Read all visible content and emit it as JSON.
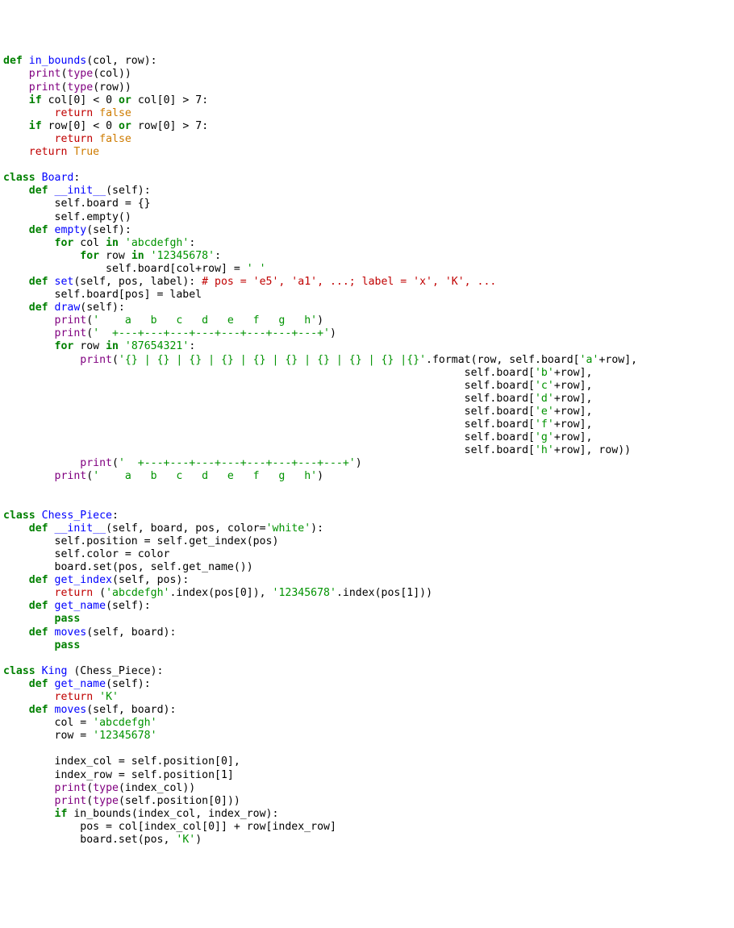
{
  "code": {
    "lines": [
      [
        [
          "kw",
          "def "
        ],
        [
          "name",
          "in_bounds"
        ],
        [
          "n",
          "(col, row):"
        ]
      ],
      [
        [
          "n",
          "    "
        ],
        [
          "purple",
          "print"
        ],
        [
          "n",
          "("
        ],
        [
          "purple",
          "type"
        ],
        [
          "n",
          "(col))"
        ]
      ],
      [
        [
          "n",
          "    "
        ],
        [
          "purple",
          "print"
        ],
        [
          "n",
          "("
        ],
        [
          "purple",
          "type"
        ],
        [
          "n",
          "(row))"
        ]
      ],
      [
        [
          "n",
          "    "
        ],
        [
          "kw",
          "if"
        ],
        [
          "n",
          " col["
        ],
        [
          "n",
          "0"
        ],
        [
          "n",
          "] < "
        ],
        [
          "n",
          "0"
        ],
        [
          "n",
          " "
        ],
        [
          "kw",
          "or"
        ],
        [
          "n",
          " col["
        ],
        [
          "n",
          "0"
        ],
        [
          "n",
          "] > "
        ],
        [
          "n",
          "7"
        ],
        [
          "n",
          ":"
        ]
      ],
      [
        [
          "n",
          "        "
        ],
        [
          "red",
          "return"
        ],
        [
          "n",
          " "
        ],
        [
          "orange",
          "false"
        ]
      ],
      [
        [
          "n",
          "    "
        ],
        [
          "kw",
          "if"
        ],
        [
          "n",
          " row["
        ],
        [
          "n",
          "0"
        ],
        [
          "n",
          "] < "
        ],
        [
          "n",
          "0"
        ],
        [
          "n",
          " "
        ],
        [
          "kw",
          "or"
        ],
        [
          "n",
          " row["
        ],
        [
          "n",
          "0"
        ],
        [
          "n",
          "] > "
        ],
        [
          "n",
          "7"
        ],
        [
          "n",
          ":"
        ]
      ],
      [
        [
          "n",
          "        "
        ],
        [
          "red",
          "return"
        ],
        [
          "n",
          " "
        ],
        [
          "orange",
          "false"
        ]
      ],
      [
        [
          "n",
          "    "
        ],
        [
          "red",
          "return"
        ],
        [
          "n",
          " "
        ],
        [
          "orange",
          "True"
        ]
      ],
      [
        [
          "n",
          ""
        ]
      ],
      [
        [
          "kw",
          "class "
        ],
        [
          "name",
          "Board"
        ],
        [
          "n",
          ":"
        ]
      ],
      [
        [
          "n",
          "    "
        ],
        [
          "kw",
          "def "
        ],
        [
          "name",
          "__init__"
        ],
        [
          "n",
          "(self):"
        ]
      ],
      [
        [
          "n",
          "        self.board = {}"
        ]
      ],
      [
        [
          "n",
          "        self.empty()"
        ]
      ],
      [
        [
          "n",
          "    "
        ],
        [
          "kw",
          "def "
        ],
        [
          "name",
          "empty"
        ],
        [
          "n",
          "(self):"
        ]
      ],
      [
        [
          "n",
          "        "
        ],
        [
          "kw",
          "for"
        ],
        [
          "n",
          " col "
        ],
        [
          "kw",
          "in"
        ],
        [
          "n",
          " "
        ],
        [
          "str",
          "'abcdefgh'"
        ],
        [
          "n",
          ":"
        ]
      ],
      [
        [
          "n",
          "            "
        ],
        [
          "kw",
          "for"
        ],
        [
          "n",
          " row "
        ],
        [
          "kw",
          "in"
        ],
        [
          "n",
          " "
        ],
        [
          "str",
          "'12345678'"
        ],
        [
          "n",
          ":"
        ]
      ],
      [
        [
          "n",
          "                self.board[col+row] = "
        ],
        [
          "str",
          "' '"
        ]
      ],
      [
        [
          "n",
          "    "
        ],
        [
          "kw",
          "def "
        ],
        [
          "name",
          "set"
        ],
        [
          "n",
          "(self, pos, label): "
        ],
        [
          "cmt",
          "# pos = 'e5', 'a1', ...; label = 'x', 'K', ..."
        ]
      ],
      [
        [
          "n",
          "        self.board[pos] = label"
        ]
      ],
      [
        [
          "n",
          "    "
        ],
        [
          "kw",
          "def "
        ],
        [
          "name",
          "draw"
        ],
        [
          "n",
          "(self):"
        ]
      ],
      [
        [
          "n",
          "        "
        ],
        [
          "purple",
          "print"
        ],
        [
          "n",
          "("
        ],
        [
          "str",
          "'    a   b   c   d   e   f   g   h'"
        ],
        [
          "n",
          ")"
        ]
      ],
      [
        [
          "n",
          "        "
        ],
        [
          "purple",
          "print"
        ],
        [
          "n",
          "("
        ],
        [
          "str",
          "'  +---+---+---+---+---+---+---+---+'"
        ],
        [
          "n",
          ")"
        ]
      ],
      [
        [
          "n",
          "        "
        ],
        [
          "kw",
          "for"
        ],
        [
          "n",
          " row "
        ],
        [
          "kw",
          "in"
        ],
        [
          "n",
          " "
        ],
        [
          "str",
          "'87654321'"
        ],
        [
          "n",
          ":"
        ]
      ],
      [
        [
          "n",
          "            "
        ],
        [
          "purple",
          "print"
        ],
        [
          "n",
          "("
        ],
        [
          "str",
          "'{} | {} | {} | {} | {} | {} | {} | {} | {} |{}'"
        ],
        [
          "n",
          ".format(row, self.board["
        ],
        [
          "str",
          "'a'"
        ],
        [
          "n",
          "+row],"
        ]
      ],
      [
        [
          "n",
          "                                                                        self.board["
        ],
        [
          "str",
          "'b'"
        ],
        [
          "n",
          "+row],"
        ]
      ],
      [
        [
          "n",
          "                                                                        self.board["
        ],
        [
          "str",
          "'c'"
        ],
        [
          "n",
          "+row],"
        ]
      ],
      [
        [
          "n",
          "                                                                        self.board["
        ],
        [
          "str",
          "'d'"
        ],
        [
          "n",
          "+row],"
        ]
      ],
      [
        [
          "n",
          "                                                                        self.board["
        ],
        [
          "str",
          "'e'"
        ],
        [
          "n",
          "+row],"
        ]
      ],
      [
        [
          "n",
          "                                                                        self.board["
        ],
        [
          "str",
          "'f'"
        ],
        [
          "n",
          "+row],"
        ]
      ],
      [
        [
          "n",
          "                                                                        self.board["
        ],
        [
          "str",
          "'g'"
        ],
        [
          "n",
          "+row],"
        ]
      ],
      [
        [
          "n",
          "                                                                        self.board["
        ],
        [
          "str",
          "'h'"
        ],
        [
          "n",
          "+row], row))"
        ]
      ],
      [
        [
          "n",
          "            "
        ],
        [
          "purple",
          "print"
        ],
        [
          "n",
          "("
        ],
        [
          "str",
          "'  +---+---+---+---+---+---+---+---+'"
        ],
        [
          "n",
          ")"
        ]
      ],
      [
        [
          "n",
          "        "
        ],
        [
          "purple",
          "print"
        ],
        [
          "n",
          "("
        ],
        [
          "str",
          "'    a   b   c   d   e   f   g   h'"
        ],
        [
          "n",
          ")"
        ]
      ],
      [
        [
          "n",
          ""
        ]
      ],
      [
        [
          "n",
          ""
        ]
      ],
      [
        [
          "kw",
          "class "
        ],
        [
          "name",
          "Chess_Piece"
        ],
        [
          "n",
          ":"
        ]
      ],
      [
        [
          "n",
          "    "
        ],
        [
          "kw",
          "def "
        ],
        [
          "name",
          "__init__"
        ],
        [
          "n",
          "(self, board, pos, color="
        ],
        [
          "str",
          "'white'"
        ],
        [
          "n",
          "):"
        ]
      ],
      [
        [
          "n",
          "        self.position = self.get_index(pos)"
        ]
      ],
      [
        [
          "n",
          "        self.color = color"
        ]
      ],
      [
        [
          "n",
          "        board.set(pos, self.get_name())"
        ]
      ],
      [
        [
          "n",
          "    "
        ],
        [
          "kw",
          "def "
        ],
        [
          "name",
          "get_index"
        ],
        [
          "n",
          "(self, pos):"
        ]
      ],
      [
        [
          "n",
          "        "
        ],
        [
          "red",
          "return"
        ],
        [
          "n",
          " ("
        ],
        [
          "str",
          "'abcdefgh'"
        ],
        [
          "n",
          ".index(pos["
        ],
        [
          "n",
          "0"
        ],
        [
          "n",
          "]), "
        ],
        [
          "str",
          "'12345678'"
        ],
        [
          "n",
          ".index(pos["
        ],
        [
          "n",
          "1"
        ],
        [
          "n",
          "]))"
        ]
      ],
      [
        [
          "n",
          "    "
        ],
        [
          "kw",
          "def "
        ],
        [
          "name",
          "get_name"
        ],
        [
          "n",
          "(self):"
        ]
      ],
      [
        [
          "n",
          "        "
        ],
        [
          "kw",
          "pass"
        ]
      ],
      [
        [
          "n",
          "    "
        ],
        [
          "kw",
          "def "
        ],
        [
          "name",
          "moves"
        ],
        [
          "n",
          "(self, board):"
        ]
      ],
      [
        [
          "n",
          "        "
        ],
        [
          "kw",
          "pass"
        ]
      ],
      [
        [
          "n",
          ""
        ]
      ],
      [
        [
          "kw",
          "class "
        ],
        [
          "name",
          "King"
        ],
        [
          "n",
          " (Chess_Piece):"
        ]
      ],
      [
        [
          "n",
          "    "
        ],
        [
          "kw",
          "def "
        ],
        [
          "name",
          "get_name"
        ],
        [
          "n",
          "(self):"
        ]
      ],
      [
        [
          "n",
          "        "
        ],
        [
          "red",
          "return"
        ],
        [
          "n",
          " "
        ],
        [
          "str",
          "'K'"
        ]
      ],
      [
        [
          "n",
          "    "
        ],
        [
          "kw",
          "def "
        ],
        [
          "name",
          "moves"
        ],
        [
          "n",
          "(self, board):"
        ]
      ],
      [
        [
          "n",
          "        col = "
        ],
        [
          "str",
          "'abcdefgh'"
        ]
      ],
      [
        [
          "n",
          "        row = "
        ],
        [
          "str",
          "'12345678'"
        ]
      ],
      [
        [
          "n",
          ""
        ]
      ],
      [
        [
          "n",
          "        index_col = self.position["
        ],
        [
          "n",
          "0"
        ],
        [
          "n",
          "],"
        ]
      ],
      [
        [
          "n",
          "        index_row = self.position["
        ],
        [
          "n",
          "1"
        ],
        [
          "n",
          "]"
        ]
      ],
      [
        [
          "n",
          "        "
        ],
        [
          "purple",
          "print"
        ],
        [
          "n",
          "("
        ],
        [
          "purple",
          "type"
        ],
        [
          "n",
          "(index_col))"
        ]
      ],
      [
        [
          "n",
          "        "
        ],
        [
          "purple",
          "print"
        ],
        [
          "n",
          "("
        ],
        [
          "purple",
          "type"
        ],
        [
          "n",
          "(self.position["
        ],
        [
          "n",
          "0"
        ],
        [
          "n",
          "]))"
        ]
      ],
      [
        [
          "n",
          "        "
        ],
        [
          "kw",
          "if"
        ],
        [
          "n",
          " in_bounds(index_col, index_row):"
        ]
      ],
      [
        [
          "n",
          "            pos = col[index_col["
        ],
        [
          "n",
          "0"
        ],
        [
          "n",
          "]] + row[index_row]"
        ]
      ],
      [
        [
          "n",
          "            board.set(pos, "
        ],
        [
          "str",
          "'K'"
        ],
        [
          "n",
          ")"
        ]
      ],
      [
        [
          "n",
          ""
        ]
      ]
    ]
  }
}
